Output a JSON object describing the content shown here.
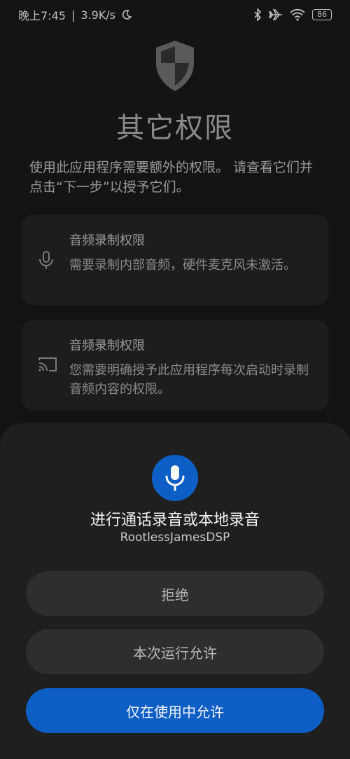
{
  "status": {
    "time": "晚上7:45",
    "separator": "|",
    "speed": "3.9K/s",
    "battery": "86",
    "icons": [
      "moon-icon",
      "bluetooth-icon",
      "airplane-icon",
      "wifi-icon",
      "battery-icon"
    ]
  },
  "header": {
    "title": "其它权限",
    "description": "使用此应用程序需要额外的权限。 请查看它们并点击“下一步”以授予它们。"
  },
  "permissions": [
    {
      "icon": "microphone-icon",
      "title": "音频录制权限",
      "text": "需要录制内部音频，硬件麦克风未激活。"
    },
    {
      "icon": "cast-icon",
      "title": "音频录制权限",
      "text": "您需要明确授予此应用程序每次启动时录制音频内容的权限。"
    }
  ],
  "dialog": {
    "icon": "microphone-icon",
    "title": "进行通话录音或本地录音",
    "app_name": "RootlessJamesDSP",
    "buttons": {
      "deny": "拒绝",
      "allow_once": "本次运行允许",
      "allow_while_using": "仅在使用中允许"
    }
  },
  "colors": {
    "accent": "#0d5fc6",
    "sheet": "#1f1f1f",
    "background": "#141414"
  }
}
